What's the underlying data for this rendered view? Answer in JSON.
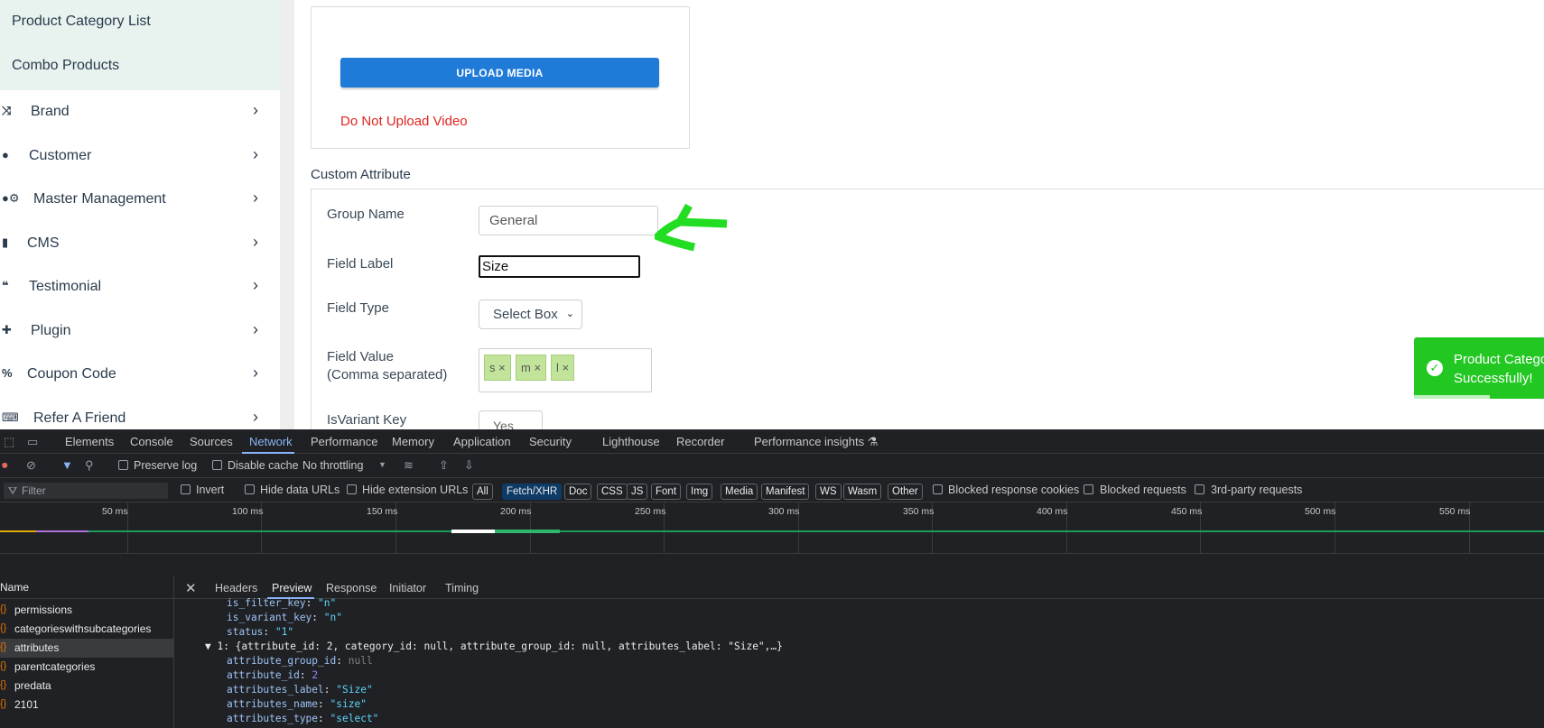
{
  "sidebar": {
    "sub_items": [
      "Product Category List",
      "Combo Products"
    ],
    "items": [
      {
        "label": "Brand",
        "icon": "shuffle-icon"
      },
      {
        "label": "Customer",
        "icon": "user-icon"
      },
      {
        "label": "Master Management",
        "icon": "user-cog-icon"
      },
      {
        "label": "CMS",
        "icon": "file-icon"
      },
      {
        "label": "Testimonial",
        "icon": "quote-icon"
      },
      {
        "label": "Plugin",
        "icon": "puzzle-icon"
      },
      {
        "label": "Coupon Code",
        "icon": "percent-icon"
      },
      {
        "label": "Refer A Friend",
        "icon": "keyboard-icon"
      }
    ]
  },
  "upload": {
    "button_label": "UPLOAD MEDIA",
    "warning": "Do Not Upload Video"
  },
  "custom_attribute": {
    "title": "Custom Attribute",
    "group_name_label": "Group Name",
    "group_name_value": "General",
    "field_label_label": "Field Label",
    "field_label_value": "Size",
    "field_type_label": "Field Type",
    "field_type_value": "Select Box",
    "field_value_label_1": "Field Value",
    "field_value_label_2": "(Comma separated)",
    "tags": [
      "s ×",
      "m ×",
      "l ×"
    ],
    "is_variant_label": "IsVariant Key",
    "is_variant_value": "Yes"
  },
  "toast": {
    "line1": "Product Categor",
    "line2": "Successfully!",
    "color": "#22c722"
  },
  "annotation": {
    "arrow_color": "#22dd22"
  },
  "devtools": {
    "tabs": [
      "Elements",
      "Console",
      "Sources",
      "Network",
      "Performance",
      "Memory",
      "Application",
      "Security",
      "Lighthouse",
      "Recorder",
      "Performance insights ⚗"
    ],
    "active_tab": "Network",
    "toolbar": {
      "preserve_log": "Preserve log",
      "disable_cache": "Disable cache",
      "throttling": "No throttling"
    },
    "filter": {
      "placeholder": "Filter",
      "invert": "Invert",
      "hide_data_urls": "Hide data URLs",
      "hide_extension_urls": "Hide extension URLs",
      "types": [
        "All",
        "Fetch/XHR",
        "Doc",
        "CSS",
        "JS",
        "Font",
        "Img",
        "Media",
        "Manifest",
        "WS",
        "Wasm",
        "Other"
      ],
      "active_type": "Fetch/XHR",
      "blocked_cookies": "Blocked response cookies",
      "blocked_requests": "Blocked requests",
      "third_party": "3rd-party requests"
    },
    "timeline_ticks": [
      "50 ms",
      "100 ms",
      "150 ms",
      "200 ms",
      "250 ms",
      "300 ms",
      "350 ms",
      "400 ms",
      "450 ms",
      "500 ms",
      "550 ms"
    ],
    "request_list": {
      "header": "Name",
      "items": [
        "permissions",
        "categorieswithsubcategories",
        "attributes",
        "parentcategories",
        "predata",
        "2101"
      ],
      "selected": "attributes"
    },
    "detail_tabs": [
      "Headers",
      "Preview",
      "Response",
      "Initiator",
      "Timing"
    ],
    "active_detail_tab": "Preview",
    "preview": {
      "l1_key": "is_filter_key",
      "l1_val": "\"n\"",
      "l2_key": "is_variant_key",
      "l2_val": "\"n\"",
      "l3_key": "status",
      "l3_val": "\"1\"",
      "l4": "▼ 1: {attribute_id: 2, category_id: null, attribute_group_id: null, attributes_label: \"Size\",…}",
      "l5_key": "attribute_group_id",
      "l5_val": "null",
      "l6_key": "attribute_id",
      "l6_val": "2",
      "l7_key": "attributes_label",
      "l7_val": "\"Size\"",
      "l8_key": "attributes_name",
      "l8_val": "\"size\"",
      "l9_key": "attributes_type",
      "l9_val": "\"select\""
    }
  }
}
